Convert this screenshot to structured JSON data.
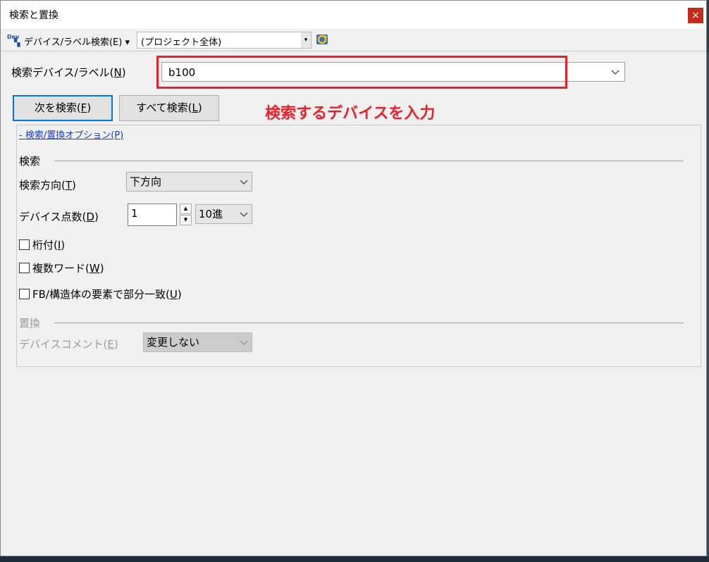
{
  "window": {
    "title": "検索と置換",
    "close_label": "×"
  },
  "toolbar": {
    "icon_text": "Dev",
    "search_mode_label": "デバイス/ラベル検索(E)",
    "search_mode_arrow": "▾",
    "scope_value": "(プロジェクト全体)",
    "scope_arrow": "▾"
  },
  "search": {
    "label_pre": "検索デバイス/ラベル(",
    "label_key": "N",
    "label_post": ")",
    "value": "b100"
  },
  "buttons": {
    "find_next": {
      "pre": "次を検索(",
      "key": "F",
      "post": ")"
    },
    "find_all": {
      "pre": "すべて検索(",
      "key": "L",
      "post": ")"
    }
  },
  "annotation": {
    "text": "検索するデバイスを入力",
    "color": "#e8202a"
  },
  "options": {
    "toggle_label": "- 検索/置換オプション(P)",
    "search_section": "検索",
    "direction": {
      "pre": "検索方向(",
      "key": "T",
      "post": ")",
      "value": "下方向"
    },
    "count": {
      "pre": "デバイス点数(",
      "key": "D",
      "post": ")",
      "value": "1",
      "up": "▲",
      "down": "▼",
      "radix": "10進"
    },
    "checkboxes": [
      {
        "pre": "桁付(",
        "key": "I",
        "post": ")",
        "checked": false
      },
      {
        "pre": "複数ワード(",
        "key": "W",
        "post": ")",
        "checked": false
      },
      {
        "pre": "FB/構造体の要素で部分一致(",
        "key": "U",
        "post": ")",
        "checked": false
      }
    ],
    "replace_section": "置換",
    "comment": {
      "pre": "デバイスコメント(",
      "key": "E",
      "post": ")",
      "value": "変更しない"
    }
  }
}
